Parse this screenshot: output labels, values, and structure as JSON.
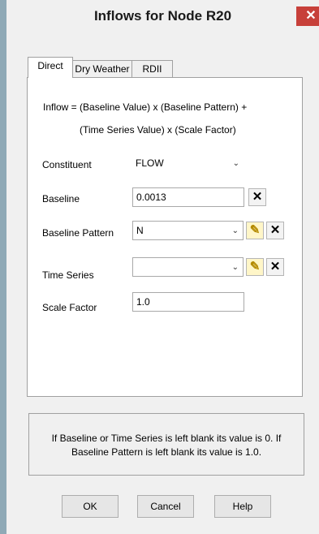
{
  "window": {
    "title": "Inflows for Node R20",
    "close_symbol": "✕"
  },
  "tabs": [
    {
      "label": "Direct",
      "active": true
    },
    {
      "label": "Dry Weather",
      "active": false
    },
    {
      "label": "RDII",
      "active": false
    }
  ],
  "formula": {
    "line1": "Inflow  =  (Baseline Value) x (Baseline Pattern) +",
    "line2": "(Time Series Value) x (Scale Factor)"
  },
  "fields": {
    "constituent": {
      "label": "Constituent",
      "value": "FLOW"
    },
    "baseline": {
      "label": "Baseline",
      "value": "0.0013"
    },
    "baseline_pattern": {
      "label": "Baseline Pattern",
      "value": "N"
    },
    "time_series": {
      "label": "Time Series",
      "value": ""
    },
    "scale_factor": {
      "label": "Scale Factor",
      "value": "1.0"
    }
  },
  "icons": {
    "delete_symbol": "✕",
    "edit_symbol": "✎",
    "dropdown_symbol": "⌄"
  },
  "note": "If Baseline or Time Series is left blank its value is 0. If Baseline Pattern is left blank its value is 1.0.",
  "buttons": {
    "ok": "OK",
    "cancel": "Cancel",
    "help": "Help"
  },
  "colors": {
    "close": "#c7403a",
    "edge": "#8fa9b6"
  }
}
